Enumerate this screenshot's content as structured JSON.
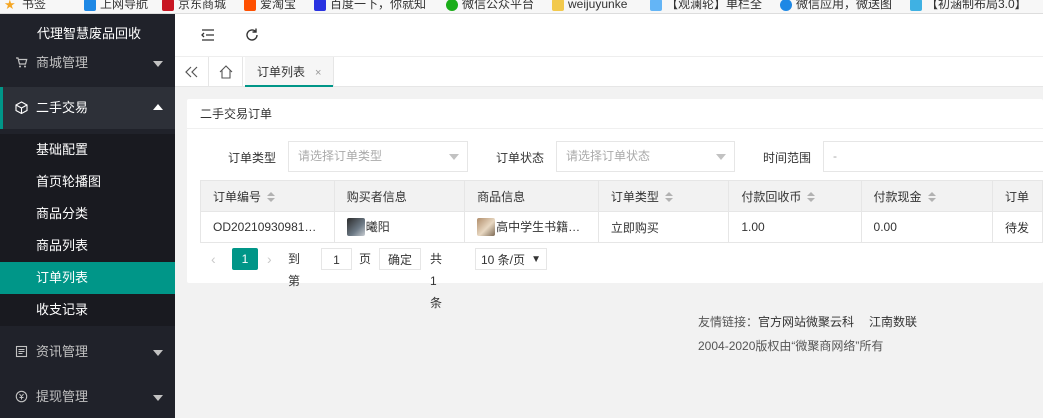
{
  "bookmarks": [
    {
      "label": "书签",
      "icon": "star-icon",
      "color": "#f5a623"
    },
    {
      "label": "上网导航",
      "icon": "e-icon",
      "color": "#1e88e5"
    },
    {
      "label": "京东商城",
      "icon": "jd-icon",
      "color": "#c81623"
    },
    {
      "label": "爱淘宝",
      "icon": "taobao-icon",
      "color": "#ff5000"
    },
    {
      "label": "百度一下，你就知",
      "icon": "baidu-icon",
      "color": "#2932e1"
    },
    {
      "label": "微信公众平台",
      "icon": "wechat-icon",
      "color": "#1aad19"
    },
    {
      "label": "weijuyunke",
      "icon": "folder-icon",
      "color": "#f2c94c"
    },
    {
      "label": "【观澜轮】单栏全",
      "icon": "page-icon",
      "color": "#64b5f6"
    },
    {
      "label": "微信应用，微送图",
      "icon": "globe-icon",
      "color": "#1e88e5"
    },
    {
      "label": "【初涵制布局3.0】",
      "icon": "hbuilder-icon",
      "color": "#3fb1e3"
    }
  ],
  "sidebar": {
    "top_label": "代理智慧废品回收",
    "menus": [
      {
        "label": "商城管理",
        "icon": "cart-icon"
      },
      {
        "label": "二手交易",
        "icon": "cube-icon",
        "open": true
      },
      {
        "label": "资讯管理",
        "icon": "news-icon"
      },
      {
        "label": "提现管理",
        "icon": "withdraw-icon"
      }
    ],
    "subitems": [
      "基础配置",
      "首页轮播图",
      "商品分类",
      "商品列表",
      "订单列表",
      "收支记录"
    ],
    "active_sub": "订单列表"
  },
  "tabs": {
    "active": {
      "label": "订单列表",
      "close": "×"
    }
  },
  "card": {
    "title": "二手交易订单",
    "filters": {
      "order_type_label": "订单类型",
      "order_type_placeholder": "请选择订单类型",
      "order_status_label": "订单状态",
      "order_status_placeholder": "请选择订单状态",
      "time_range_label": "时间范围",
      "time_range_value": "-"
    },
    "table": {
      "headers": [
        "订单编号",
        "购买者信息",
        "商品信息",
        "订单类型",
        "付款回收币",
        "付款现金",
        "订单"
      ],
      "rows": [
        {
          "order_no": "OD20210930981…",
          "buyer": "曦阳",
          "product": "高中学生书籍…",
          "type": "立即购买",
          "coins": "1.00",
          "cash": "0.00",
          "status": "待发"
        }
      ]
    },
    "pager": {
      "current": "1",
      "goto_label": "到第",
      "goto_value": "1",
      "page_unit": "页",
      "confirm": "确定",
      "total": "共 1 条",
      "size": "10 条/页"
    }
  },
  "footer": {
    "links_label": "友情链接：",
    "link1": "官方网站微聚云科",
    "link2": "江南数联",
    "copyright": "2004-2020版权由“微聚商网络”所有"
  },
  "colors": {
    "accent": "#009688",
    "sidebar": "#20222a"
  }
}
